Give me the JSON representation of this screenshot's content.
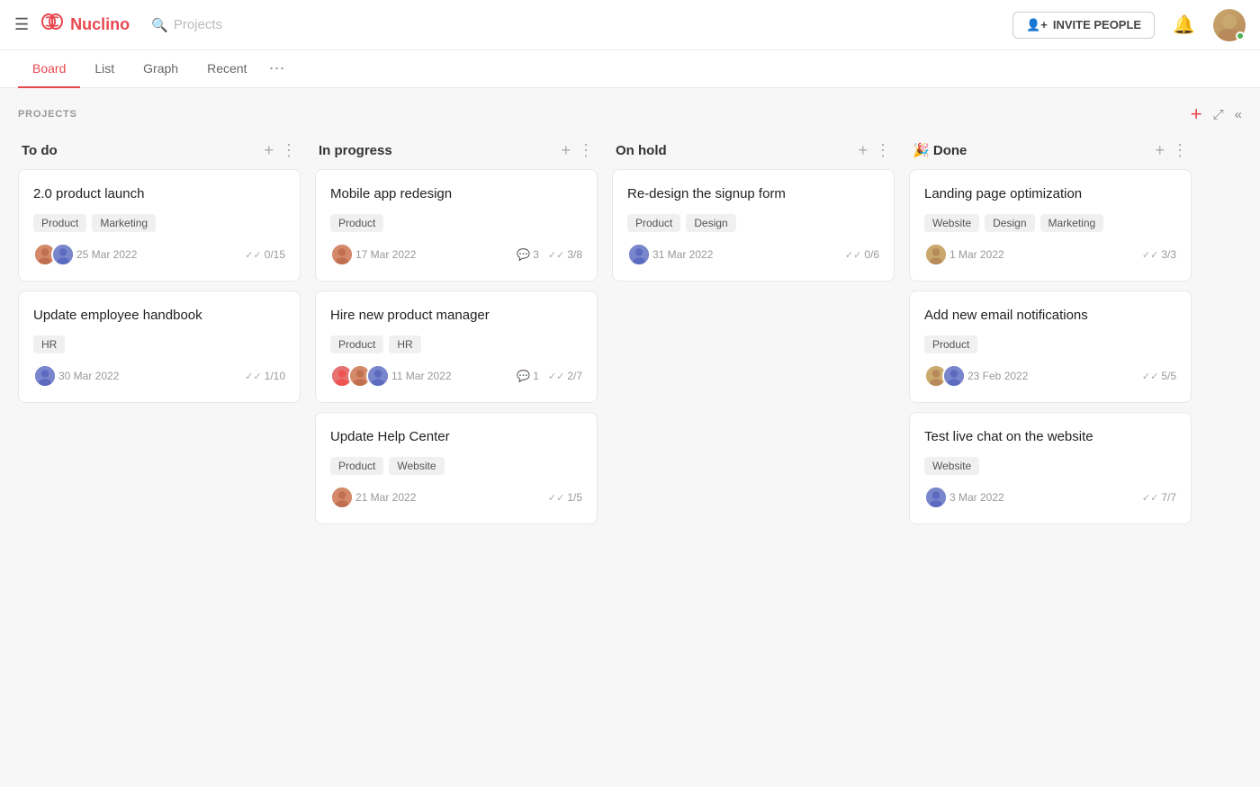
{
  "app": {
    "logo": "Nuclino",
    "search_placeholder": "Projects"
  },
  "nav": {
    "invite_label": "INVITE PEOPLE",
    "tabs": [
      {
        "id": "board",
        "label": "Board",
        "active": true
      },
      {
        "id": "list",
        "label": "List",
        "active": false
      },
      {
        "id": "graph",
        "label": "Graph",
        "active": false
      },
      {
        "id": "recent",
        "label": "Recent",
        "active": false
      }
    ]
  },
  "board": {
    "section_label": "PROJECTS",
    "columns": [
      {
        "id": "todo",
        "title": "To do",
        "emoji": "",
        "cards": [
          {
            "id": "c1",
            "title": "2.0 product launch",
            "tags": [
              "Product",
              "Marketing"
            ],
            "date": "25 Mar 2022",
            "checks": "0/15",
            "comments": "",
            "avatars": [
              "a1",
              "a2"
            ]
          },
          {
            "id": "c2",
            "title": "Update employee handbook",
            "tags": [
              "HR"
            ],
            "date": "30 Mar 2022",
            "checks": "1/10",
            "comments": "",
            "avatars": [
              "a2"
            ]
          }
        ]
      },
      {
        "id": "inprogress",
        "title": "In progress",
        "emoji": "",
        "cards": [
          {
            "id": "c3",
            "title": "Mobile app redesign",
            "tags": [
              "Product"
            ],
            "date": "17 Mar 2022",
            "checks": "3/8",
            "comments": "3",
            "avatars": [
              "a1"
            ]
          },
          {
            "id": "c4",
            "title": "Hire new product manager",
            "tags": [
              "Product",
              "HR"
            ],
            "date": "11 Mar 2022",
            "checks": "2/7",
            "comments": "1",
            "avatars": [
              "a3",
              "a1",
              "a2"
            ]
          },
          {
            "id": "c5",
            "title": "Update Help Center",
            "tags": [
              "Product",
              "Website"
            ],
            "date": "21 Mar 2022",
            "checks": "1/5",
            "comments": "",
            "avatars": [
              "a1"
            ]
          }
        ]
      },
      {
        "id": "onhold",
        "title": "On hold",
        "emoji": "",
        "cards": [
          {
            "id": "c6",
            "title": "Re-design the signup form",
            "tags": [
              "Product",
              "Design"
            ],
            "date": "31 Mar 2022",
            "checks": "0/6",
            "comments": "",
            "avatars": [
              "a2"
            ]
          }
        ]
      },
      {
        "id": "done",
        "title": "Done",
        "emoji": "🎉",
        "cards": [
          {
            "id": "c7",
            "title": "Landing page optimization",
            "tags": [
              "Website",
              "Design",
              "Marketing"
            ],
            "date": "1 Mar 2022",
            "checks": "3/3",
            "comments": "",
            "avatars": [
              "a5"
            ]
          },
          {
            "id": "c8",
            "title": "Add new email notifications",
            "tags": [
              "Product"
            ],
            "date": "23 Feb 2022",
            "checks": "5/5",
            "comments": "",
            "avatars": [
              "a5",
              "a2"
            ]
          },
          {
            "id": "c9",
            "title": "Test live chat on the website",
            "tags": [
              "Website"
            ],
            "date": "3 Mar 2022",
            "checks": "7/7",
            "comments": "",
            "avatars": [
              "a2"
            ]
          }
        ]
      }
    ]
  }
}
